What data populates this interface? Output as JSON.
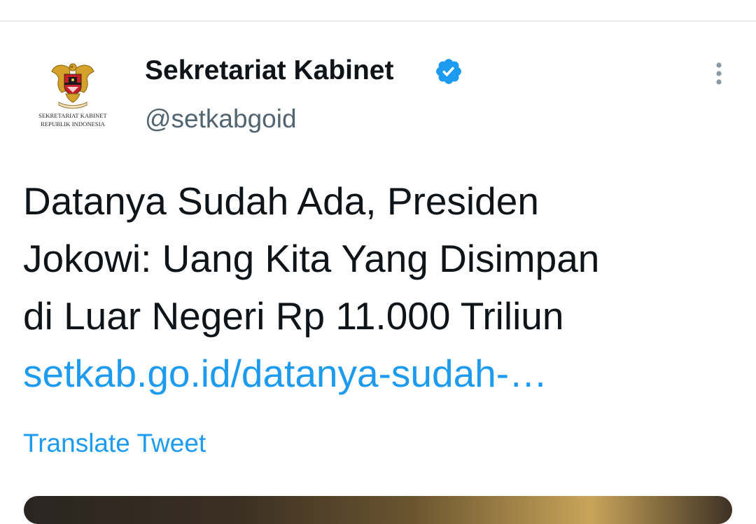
{
  "account": {
    "display_name": "Sekretariat Kabinet",
    "handle": "@setkabgoid",
    "verified": true,
    "avatar": {
      "icon": "garuda-emblem-icon",
      "caption_line1": "SEKRETARIAT KABINET",
      "caption_line2": "REPUBLIK INDONESIA"
    }
  },
  "tweet": {
    "text_lines": [
      "Datanya Sudah Ada, Presiden",
      "Jokowi: Uang Kita Yang Disimpan",
      "di Luar Negeri Rp 11.000 Triliun"
    ],
    "link_text": "setkab.go.id/datanya-sudah-…",
    "translate_label": "Translate Tweet"
  },
  "colors": {
    "link": "#1d9bf0",
    "verified": "#1d9bf0",
    "handle": "#536471",
    "text": "#0f1419"
  }
}
